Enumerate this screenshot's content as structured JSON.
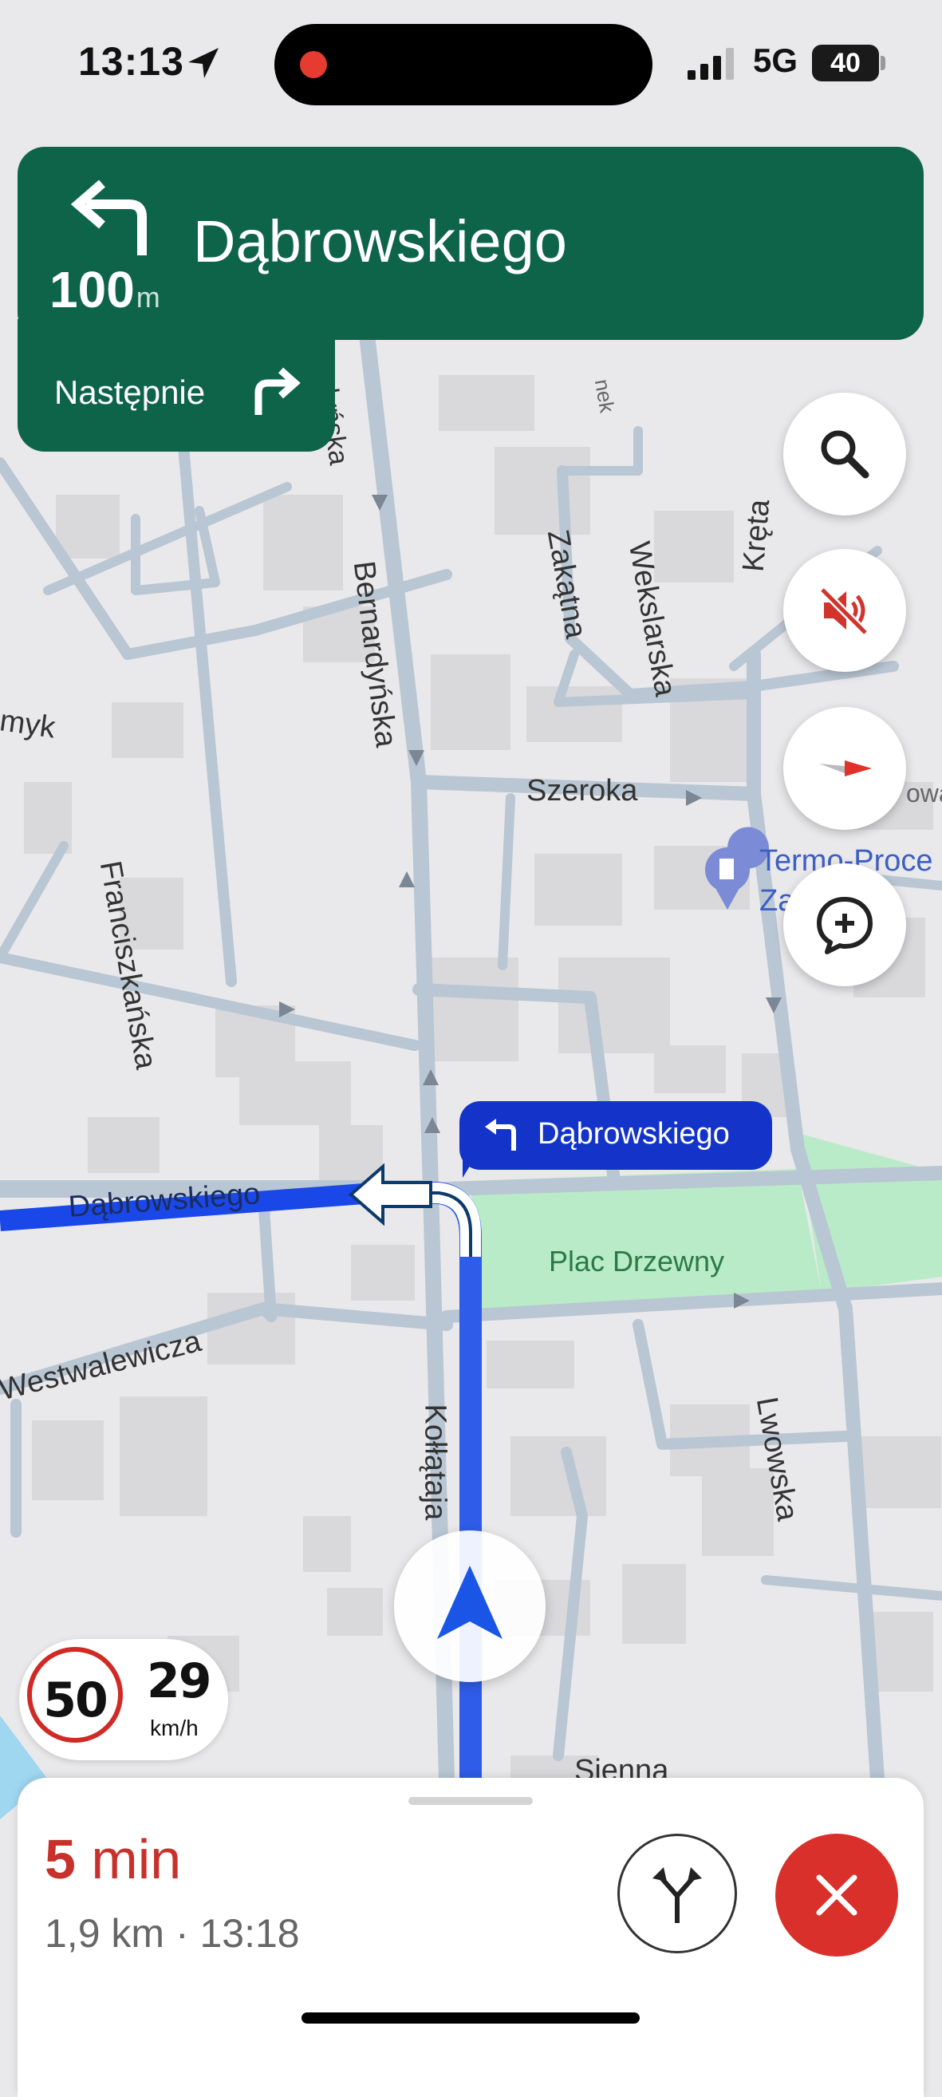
{
  "status_bar": {
    "time": "13:13",
    "network": "5G",
    "battery": "40"
  },
  "navigation": {
    "maneuver_icon": "turn-left-icon",
    "distance_value": "100",
    "distance_unit": "m",
    "street": "Dąbrowskiego",
    "next_label": "Następnie",
    "next_icon": "turn-right-icon",
    "banner_color": "#0e6449"
  },
  "side_buttons": [
    {
      "name": "search-button",
      "icon": "search-icon"
    },
    {
      "name": "mute-button",
      "icon": "sound-off-icon"
    },
    {
      "name": "compass-button",
      "icon": "compass-icon"
    },
    {
      "name": "report-button",
      "icon": "add-report-icon"
    }
  ],
  "map": {
    "street_labels": {
      "bernardynska": "Bernardyńska",
      "bernardynska_top": "rdyńska",
      "zakatna": "Zakątna",
      "wekslarska": "Wekslarska",
      "kreta": "Kręta",
      "szeroka": "Szeroka",
      "franciszkanska": "Franciszkańska",
      "myk": "myk",
      "dabrowskiego": "Dąbrowskiego",
      "westwalewicza": "Westwalewicza",
      "kollataja": "Kołłątaja",
      "lwowska": "Lwowska",
      "sienna": "Sienna",
      "plac": "Plac Drzewny",
      "nek": "nek",
      "owa": "owa"
    },
    "poi": {
      "line1": "Termo-Proce",
      "line2": "Za      ki M"
    },
    "route_color": "#1a47e8",
    "callout_text": "Dąbrowskiego"
  },
  "speed": {
    "limit": "50",
    "current": "29",
    "unit": "km/h"
  },
  "trip": {
    "eta_number": "5",
    "eta_unit": "min",
    "details": "1,9 km · 13:18",
    "eta_color": "#c8312b"
  },
  "controls": {
    "alternatives_icon": "route-alternatives-icon",
    "close_icon": "close-icon"
  }
}
